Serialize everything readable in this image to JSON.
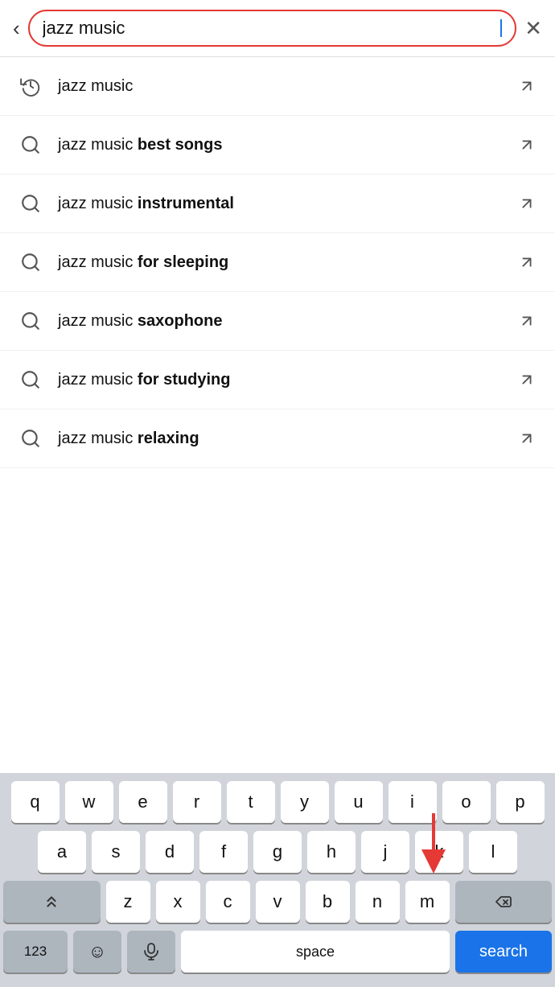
{
  "header": {
    "search_value": "jazz music",
    "close_label": "×"
  },
  "suggestions": [
    {
      "id": 1,
      "icon_type": "history",
      "text_plain": "jazz music",
      "text_bold": "",
      "has_arrow": true
    },
    {
      "id": 2,
      "icon_type": "search",
      "text_plain": "jazz music ",
      "text_bold": "best songs",
      "has_arrow": true
    },
    {
      "id": 3,
      "icon_type": "search",
      "text_plain": "jazz music ",
      "text_bold": "instrumental",
      "has_arrow": true
    },
    {
      "id": 4,
      "icon_type": "search",
      "text_plain": "jazz music ",
      "text_bold": "for sleeping",
      "has_arrow": true
    },
    {
      "id": 5,
      "icon_type": "search",
      "text_plain": "jazz music ",
      "text_bold": "saxophone",
      "has_arrow": true
    },
    {
      "id": 6,
      "icon_type": "search",
      "text_plain": "jazz music ",
      "text_bold": "for studying",
      "has_arrow": true
    },
    {
      "id": 7,
      "icon_type": "search",
      "text_plain": "jazz music ",
      "text_bold": "relaxing",
      "has_arrow": true
    }
  ],
  "keyboard": {
    "rows": [
      [
        "q",
        "w",
        "e",
        "r",
        "t",
        "y",
        "u",
        "i",
        "o",
        "p"
      ],
      [
        "a",
        "s",
        "d",
        "f",
        "g",
        "h",
        "j",
        "k",
        "l"
      ],
      [
        "⇧",
        "z",
        "x",
        "c",
        "v",
        "b",
        "n",
        "m",
        "⌫"
      ],
      [
        "123",
        "😊",
        "🎤",
        "space",
        "search"
      ]
    ],
    "search_label": "search",
    "space_label": "space",
    "numbers_label": "123"
  }
}
